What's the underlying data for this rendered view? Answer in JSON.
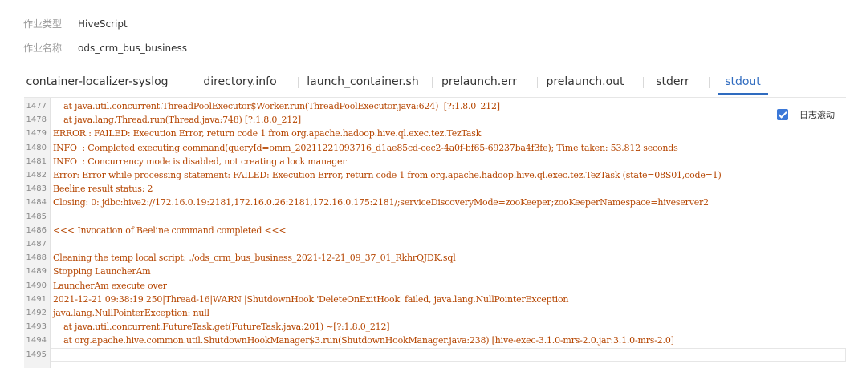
{
  "job_info": {
    "type_label": "作业类型",
    "type_value": "HiveScript",
    "name_label": "作业名称",
    "name_value": "ods_crm_bus_business"
  },
  "tabs": [
    {
      "label": "container-localizer-syslog",
      "active": false
    },
    {
      "label": "directory.info",
      "active": false
    },
    {
      "label": "launch_container.sh",
      "active": false
    },
    {
      "label": "prelaunch.err",
      "active": false
    },
    {
      "label": "prelaunch.out",
      "active": false
    },
    {
      "label": "stderr",
      "active": false
    },
    {
      "label": "stdout",
      "active": true
    }
  ],
  "auto_scroll": {
    "label": "日志滚动",
    "checked": true
  },
  "log_lines": [
    {
      "n": "1477",
      "text": "    at java.util.concurrent.ThreadPoolExecutor$Worker.run(ThreadPoolExecutor.java:624)  [?:1.8.0_212]"
    },
    {
      "n": "1478",
      "text": "    at java.lang.Thread.run(Thread.java:748) [?:1.8.0_212]"
    },
    {
      "n": "1479",
      "text": "ERROR : FAILED: Execution Error, return code 1 from org.apache.hadoop.hive.ql.exec.tez.TezTask"
    },
    {
      "n": "1480",
      "text": "INFO  : Completed executing command(queryId=omm_20211221093716_d1ae85cd-cec2-4a0f-bf65-69237ba4f3fe); Time taken: 53.812 seconds"
    },
    {
      "n": "1481",
      "text": "INFO  : Concurrency mode is disabled, not creating a lock manager"
    },
    {
      "n": "1482",
      "text": "Error: Error while processing statement: FAILED: Execution Error, return code 1 from org.apache.hadoop.hive.ql.exec.tez.TezTask (state=08S01,code=1)"
    },
    {
      "n": "1483",
      "text": "Beeline result status: 2"
    },
    {
      "n": "1484",
      "text": "Closing: 0: jdbc:hive2://172.16.0.19:2181,172.16.0.26:2181,172.16.0.175:2181/;serviceDiscoveryMode=zooKeeper;zooKeeperNamespace=hiveserver2"
    },
    {
      "n": "1485",
      "text": ""
    },
    {
      "n": "1486",
      "text": "<<< Invocation of Beeline command completed <<<"
    },
    {
      "n": "1487",
      "text": ""
    },
    {
      "n": "1488",
      "text": "Cleaning the temp local script: ./ods_crm_bus_business_2021-12-21_09_37_01_RkhrQJDK.sql"
    },
    {
      "n": "1489",
      "text": "Stopping LauncherAm"
    },
    {
      "n": "1490",
      "text": "LauncherAm execute over"
    },
    {
      "n": "1491",
      "text": "2021-12-21 09:38:19 250|Thread-16|WARN |ShutdownHook 'DeleteOnExitHook' failed, java.lang.NullPointerException"
    },
    {
      "n": "1492",
      "text": "java.lang.NullPointerException: null"
    },
    {
      "n": "1493",
      "text": "    at java.util.concurrent.FutureTask.get(FutureTask.java:201) ~[?:1.8.0_212]"
    },
    {
      "n": "1494",
      "text": "    at org.apache.hive.common.util.ShutdownHookManager$3.run(ShutdownHookManager.java:238) [hive-exec-3.1.0-mrs-2.0.jar:3.1.0-mrs-2.0]"
    },
    {
      "n": "1495",
      "text": ""
    }
  ]
}
